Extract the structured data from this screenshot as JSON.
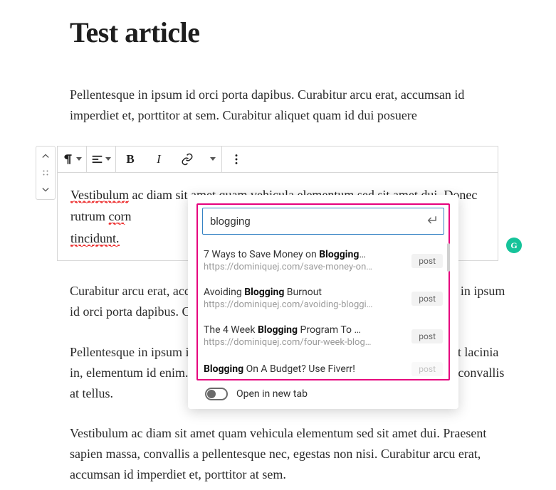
{
  "title": "Test article",
  "paragraphs": {
    "p1": "Pellentesque in ipsum id orci porta dapibus. Curabitur arcu erat, accumsan id imperdiet et, porttitor at sem. Curabitur aliquet quam id dui posuere",
    "p2_line1_a": "Vestibulum",
    "p2_line1_b": " ac diam sit ",
    "p2_line1_c": "amet quam vehicula",
    "p2_line1_d": " elementum sed sit ",
    "p2_line1_e": "amet",
    "p2_line1_f": " dui. Donec rutrum ",
    "p2_line1_g": "cor",
    "p2_line1_h": "n",
    "p2_line2": "tincidunt.",
    "p3": "Curabitur arcu erat, accumsan id imperdiet et, porttitor at sem. Pellentesque in ipsum id orci porta dapibus. Curabitur aliquet quam id dui posuere blandit.",
    "p4": "Pellentesque in ipsum id orci porta dapibus. Nulla porttitor accumsan ium ut lacinia in, elementum id enim. Pellentesque in ipsum id orci porta consectetur sed, convallis at tellus.",
    "p5": "Vestibulum ac diam sit amet quam vehicula elementum sed sit amet dui. Praesent sapien massa, convallis a pellentesque nec, egestas non nisi. Curabitur arcu erat, accumsan id imperdiet et, porttitor at sem."
  },
  "toolbar": {
    "block_type": "paragraph-icon",
    "align": "align-left-icon",
    "bold": "B",
    "italic": "I",
    "link": "link-icon",
    "more": "more-icon"
  },
  "link_popover": {
    "search_value": "blogging",
    "results": [
      {
        "title_pre": "7 Ways to Save Money on ",
        "title_bold": "Blogging",
        "title_post": "…",
        "url": "https://dominiquej.com/save-money-on…",
        "badge": "post"
      },
      {
        "title_pre": "Avoiding ",
        "title_bold": "Blogging",
        "title_post": " Burnout",
        "url": "https://dominiquej.com/avoiding-bloggi…",
        "badge": "post"
      },
      {
        "title_pre": "The 4 Week ",
        "title_bold": "Blogging",
        "title_post": " Program To …",
        "url": "https://dominiquej.com/four-week-blog…",
        "badge": "post"
      },
      {
        "title_pre": "",
        "title_bold": "Blogging",
        "title_post": " On A Budget? Use Fiverr!",
        "url": "",
        "badge": "post"
      }
    ],
    "open_new_tab_label": "Open in new tab",
    "open_new_tab": false
  },
  "grammarly": {
    "initial": "G"
  }
}
